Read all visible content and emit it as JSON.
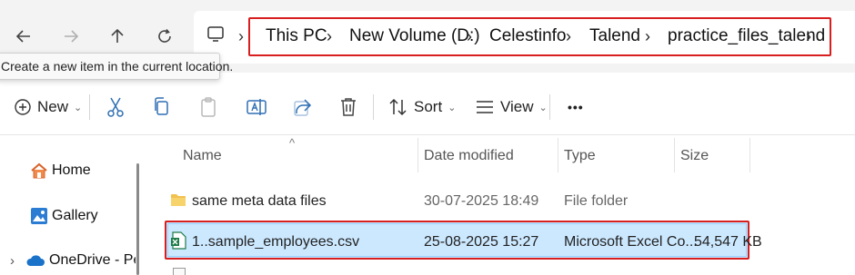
{
  "nav": {
    "back_icon": "back-arrow-icon",
    "forward_icon": "forward-arrow-icon",
    "up_icon": "up-arrow-icon",
    "refresh_icon": "refresh-icon"
  },
  "breadcrumb": {
    "items": [
      "This PC",
      "New Volume (D:)",
      "Celestinfo",
      "Talend",
      "practice_files_talend"
    ],
    "separator": ">"
  },
  "tooltip": {
    "text": "Create a new item in the current location."
  },
  "toolbar": {
    "new_label": "New",
    "sort_label": "Sort",
    "view_label": "View",
    "more_label": "•••"
  },
  "sidebar": {
    "items": [
      {
        "label": "Home",
        "icon": "home-icon"
      },
      {
        "label": "Gallery",
        "icon": "gallery-icon"
      },
      {
        "label": "OneDrive - Perso",
        "icon": "onedrive-cloud-icon"
      }
    ]
  },
  "file_list": {
    "columns": [
      "Name",
      "Date modified",
      "Type",
      "Size"
    ],
    "rows": [
      {
        "name": "same meta data files",
        "date": "30-07-2025 18:49",
        "type": "File folder",
        "size": "",
        "icon": "folder-icon"
      },
      {
        "name": "1..sample_employees.csv",
        "date": "25-08-2025 15:27",
        "type": "Microsoft Excel Co...",
        "size": "54,547 KB",
        "icon": "excel-csv-icon",
        "selected": true
      }
    ]
  },
  "colors": {
    "highlight_border": "#d81e1e",
    "selection_fill": "#cce8ff",
    "folder": "#f2c14e",
    "excel": "#1d7b45",
    "onedrive": "#1a73c9"
  }
}
